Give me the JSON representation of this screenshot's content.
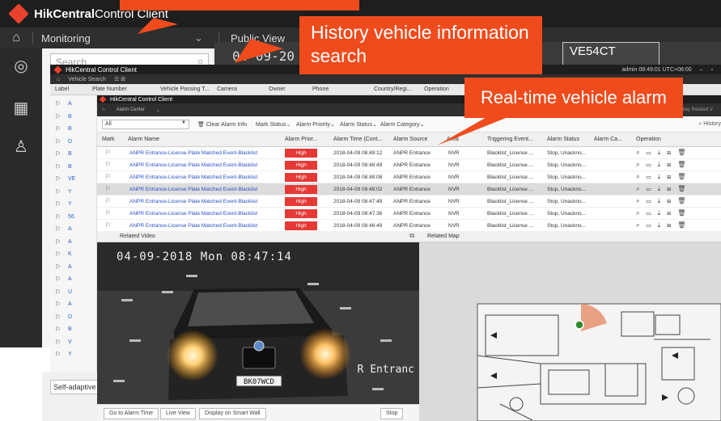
{
  "main_window": {
    "app_title_brand": "HikCentral",
    "app_title_rest": " Control Client",
    "module": "Monitoring",
    "tab": "Public View",
    "search_placeholder": "Search",
    "live_timestamp": "04-09-20",
    "live_plate": "VE54CT",
    "view_mode": "Self-adaptive"
  },
  "history_window": {
    "title": "HikCentral Control Client",
    "nav_label": "Vehicle Search",
    "status": "admin  08:49:01 UTC+08:00",
    "columns": [
      "Label",
      "Plate Number",
      "Vehicle Passing T...",
      "Camera",
      "Owner",
      "Phone",
      "Country/Regi...",
      "Operation"
    ],
    "rows": [
      "A",
      "B",
      "B",
      "D",
      "B",
      "B",
      "VE",
      "Y",
      "Y",
      "56",
      "A",
      "A",
      "K",
      "A",
      "A",
      "U",
      "A",
      "D",
      "B",
      "V",
      "Y"
    ]
  },
  "alarm_window": {
    "title": "HikCentral Control Client",
    "nav_label": "Alarm Center",
    "display_related": "Display Related V",
    "filter_all": "All",
    "clear_alarm_info": "Clear Alarm Info",
    "filters": [
      "Mark Status",
      "Alarm Priority",
      "Alarm Status",
      "Alarm Category"
    ],
    "history_link": "History",
    "columns": [
      "Mark",
      "Alarm Name",
      "Alarm Prior...",
      "Alarm Time (Cont...",
      "Alarm Source",
      "Area",
      "Triggering Event...",
      "Alarm Status",
      "Alarm Ca...",
      "Operation"
    ],
    "rows": [
      {
        "name": "ANPR Entrance-License Plate Matched Event-Blacklist",
        "priority": "High",
        "time": "2018-04-09 08:49:12",
        "source": "ANPR Entrance",
        "area": "NVR",
        "event": "Blacklist_License ...",
        "status": "Stop, Unackno..."
      },
      {
        "name": "ANPR Entrance-License Plate Matched Event-Blacklist",
        "priority": "High",
        "time": "2018-04-09 08:48:49",
        "source": "ANPR Entrance",
        "area": "NVR",
        "event": "Blacklist_License ...",
        "status": "Stop, Unackno..."
      },
      {
        "name": "ANPR Entrance-License Plate Matched Event-Blacklist",
        "priority": "High",
        "time": "2018-04-09 08:48:08",
        "source": "ANPR Entrance",
        "area": "NVR",
        "event": "Blacklist_License ...",
        "status": "Stop, Unackno..."
      },
      {
        "name": "ANPR Entrance-License Plate Matched Event-Blacklist",
        "priority": "High",
        "time": "2018-04-09 08:48:02",
        "source": "ANPR Entrance",
        "area": "NVR",
        "event": "Blacklist_License ...",
        "status": "Stop, Unackno..."
      },
      {
        "name": "ANPR Entrance-License Plate Matched Event-Blacklist",
        "priority": "High",
        "time": "2018-04-09 08:47:49",
        "source": "ANPR Entrance",
        "area": "NVR",
        "event": "Blacklist_License ...",
        "status": "Stop, Unackno..."
      },
      {
        "name": "ANPR Entrance-License Plate Matched Event-Blacklist",
        "priority": "High",
        "time": "2018-04-09 08:47:36",
        "source": "ANPR Entrance",
        "area": "NVR",
        "event": "Blacklist_License ...",
        "status": "Stop, Unackno..."
      },
      {
        "name": "ANPR Entrance-License Plate Matched Event-Blacklist",
        "priority": "High",
        "time": "2018-04-09 08:46:49",
        "source": "ANPR Entrance",
        "area": "NVR",
        "event": "Blacklist_License ...",
        "status": "Stop, Unackno..."
      }
    ],
    "selected_row": 3,
    "priority_color": "#e53935"
  },
  "related_video": {
    "header": "Related Video",
    "overlay_time": "04-09-2018 Mon 08:47:14",
    "overlay_location": "R Entranc",
    "plate": "BK07WCD",
    "buttons": [
      "Go to Alarm Time",
      "Live View",
      "Display on Smart Wall"
    ],
    "stop": "Stop"
  },
  "related_map": {
    "header": "Related Map"
  },
  "callouts": {
    "history": "History vehicle information search",
    "realtime": "Real-time vehicle alarm",
    "color": "#f04b1c"
  }
}
